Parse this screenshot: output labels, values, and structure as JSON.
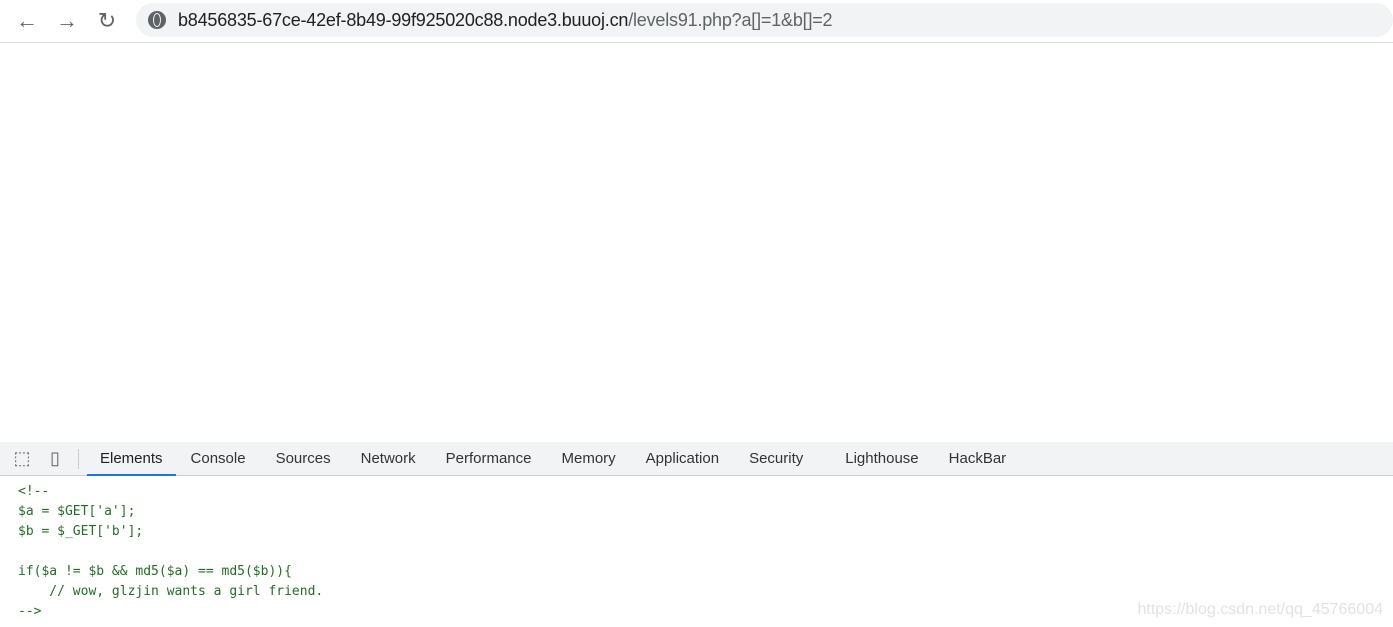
{
  "browser": {
    "url_host": "b8456835-67ce-42ef-8b49-99f925020c88.node3.buuoj.cn",
    "url_path": "/levels91.php?a[]=1&b[]=2"
  },
  "devtools": {
    "tabs": [
      "Elements",
      "Console",
      "Sources",
      "Network",
      "Performance",
      "Memory",
      "Application",
      "Security",
      "Lighthouse",
      "HackBar"
    ],
    "active_tab": "Elements",
    "code_lines": [
      "<!--",
      "$a = $GET['a'];",
      "$b = $_GET['b'];",
      "",
      "if($a != $b && md5($a) == md5($b)){",
      "    // wow, glzjin wants a girl friend.",
      "-->"
    ]
  },
  "watermark": "https://blog.csdn.net/qq_45766004"
}
